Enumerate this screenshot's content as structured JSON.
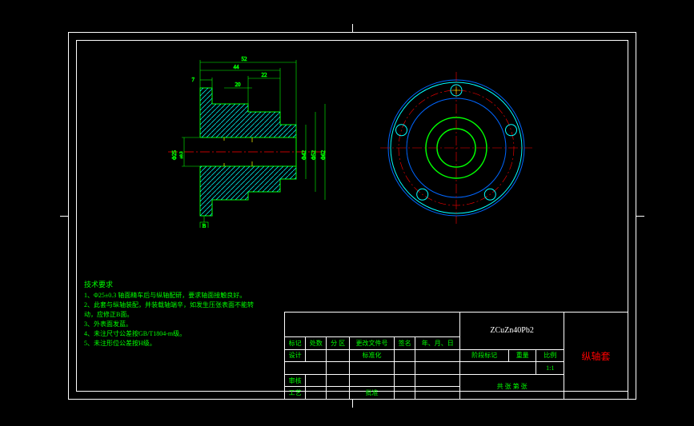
{
  "domain": "Diagram",
  "drawing": {
    "part_name": "纵轴套",
    "material": "ZCuZn40Pb2",
    "scale": "1:1",
    "section_view": {
      "dimensions": {
        "overall_length": "52",
        "step1_length": "44",
        "step2_width": "22",
        "inner_width": "20",
        "flange_thickness": "7",
        "bore_dia_label": "Φ25",
        "bore_tol_label": "±0.3",
        "dia_label1": "Φ42",
        "dia_label2": "Φ52",
        "dia_label3": "Φ62"
      },
      "datum": "B"
    },
    "front_view": {
      "bolt_holes": 5,
      "center_bore": true
    }
  },
  "notes": {
    "title": "技术要求",
    "lines": [
      "1、Φ25±0.3 轴面精车后与纵轴配研，要求轴面接触良好。",
      "2、此套与纵轴装配，并装载轴端辛，如发生压张表面不能转",
      "   动，应修正B面。",
      "3、外表面发蓝。",
      "4、未注尺寸公差按GB/T1804-m级。",
      "5、未注形位公差按H级。"
    ]
  },
  "titleblock": {
    "revision_headers": [
      "标记",
      "处数",
      "分 区",
      "更改文件号",
      "签名",
      "年、月、日"
    ],
    "row_labels": {
      "design": "设计",
      "stdize": "标准化",
      "review": "审核",
      "process": "工艺",
      "approve": "批准"
    },
    "mid_labels": {
      "stage_mark": "阶段标记",
      "weight": "重量",
      "scale_label": "比例",
      "sheet": "共    张  第    张"
    }
  }
}
